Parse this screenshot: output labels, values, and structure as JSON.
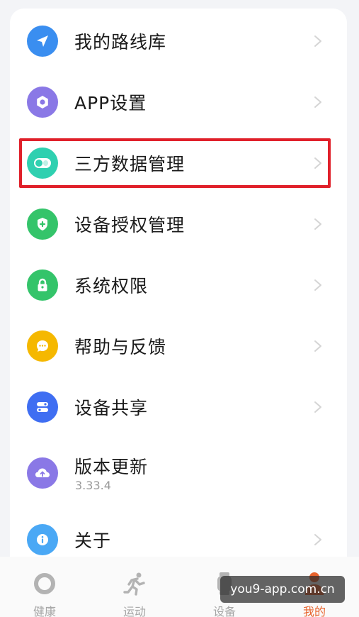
{
  "menu": {
    "items": [
      {
        "label": "我的路线库",
        "icon": "navigation-arrow-icon",
        "color": "#3a8ef0"
      },
      {
        "label": "APP设置",
        "icon": "gear-icon",
        "color": "#8a78e6"
      },
      {
        "label": "三方数据管理",
        "icon": "toggle-icon",
        "color": "#2fd0b0"
      },
      {
        "label": "设备授权管理",
        "icon": "shield-plus-icon",
        "color": "#34c46a"
      },
      {
        "label": "系统权限",
        "icon": "lock-icon",
        "color": "#34c46a"
      },
      {
        "label": "帮助与反馈",
        "icon": "chat-bubble-icon",
        "color": "#f5b800"
      },
      {
        "label": "设备共享",
        "icon": "share-toggle-icon",
        "color": "#3f6ef2"
      },
      {
        "label": "版本更新",
        "sub": "3.33.4",
        "icon": "cloud-upload-icon",
        "color": "#8a78e6"
      },
      {
        "label": "关于",
        "icon": "info-icon",
        "color": "#4aa8f5"
      }
    ],
    "highlight_color": "#e0202a"
  },
  "tabbar": {
    "tabs": [
      {
        "label": "健康",
        "icon": "ring-icon"
      },
      {
        "label": "运动",
        "icon": "runner-icon"
      },
      {
        "label": "设备",
        "icon": "watch-icon"
      },
      {
        "label": "我的",
        "icon": "person-icon"
      }
    ],
    "active_color": "#e8622b",
    "inactive_color": "#a6a6a6"
  },
  "watermark": {
    "text": "you9-app.com.cn"
  }
}
